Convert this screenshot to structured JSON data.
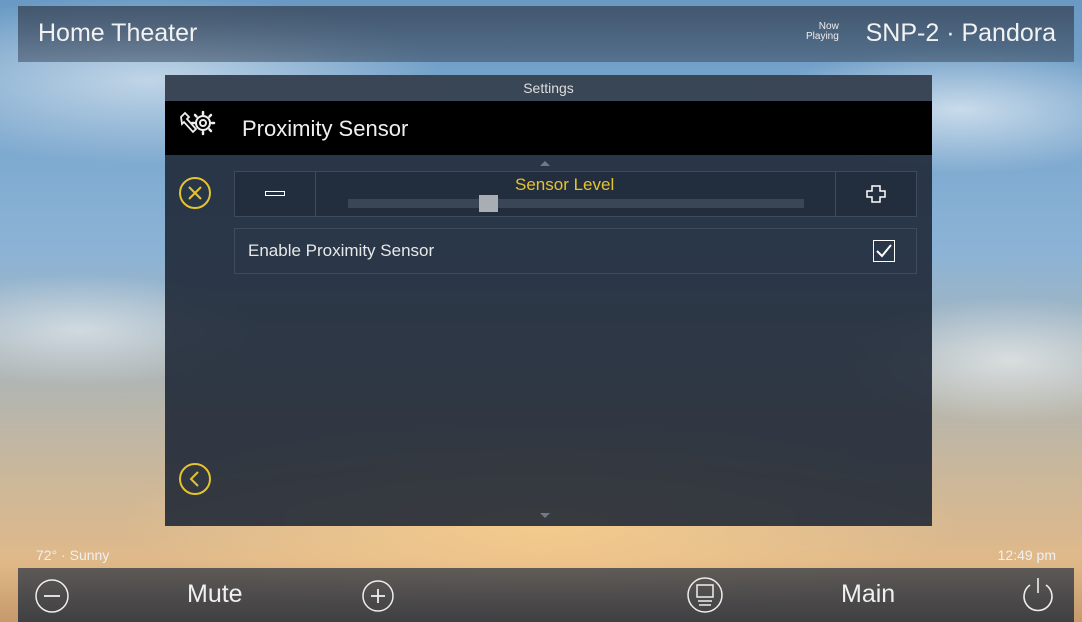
{
  "header": {
    "title": "Home Theater",
    "now_playing_line1": "Now",
    "now_playing_line2": "Playing",
    "source": "SNP-2 · Pandora"
  },
  "panel": {
    "header": "Settings",
    "section_title": "Proximity Sensor",
    "section_icon": "wrench-gear-icon"
  },
  "slider": {
    "label": "Sensor Level",
    "value_fraction": 0.3,
    "minus_icon": "minus-icon",
    "plus_icon": "plus-icon"
  },
  "checkbox": {
    "label": "Enable Proximity Sensor",
    "checked": true
  },
  "status": {
    "weather": "72° · Sunny",
    "time": "12:49 pm"
  },
  "bottom": {
    "mute_label": "Mute",
    "main_label": "Main",
    "icons": [
      "volume-down-icon",
      "volume-up-icon",
      "display-icon",
      "power-icon"
    ]
  },
  "colors": {
    "accent": "#e5c32f",
    "panel": "#1c2634"
  }
}
